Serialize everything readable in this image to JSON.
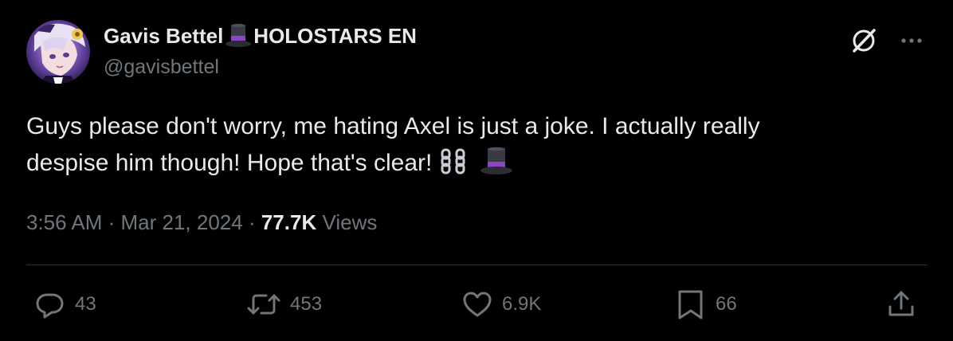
{
  "tweet": {
    "author": {
      "name_part1": "Gavis Bettel",
      "name_part2": "HOLOSTARS EN",
      "handle": "@gavisbettel",
      "avatar_icon": "avatar-image"
    },
    "text": {
      "line1": "Guys please don't worry, me hating Axel is just a joke. I actually really",
      "line2": "despise him though! Hope that's clear!"
    },
    "emojis": [
      "top-hat-emoji",
      "chains-emoji"
    ],
    "meta": {
      "time": "3:56 AM",
      "sep1": " · ",
      "date": "Mar 21, 2024",
      "sep2": " · ",
      "views_count": "77.7K",
      "views_label": " Views"
    },
    "actions": {
      "replies": "43",
      "reposts": "453",
      "likes": "6.9K",
      "bookmarks": "66"
    },
    "colors": {
      "background": "#000000",
      "text_primary": "#e7e9ea",
      "text_secondary": "#71767b",
      "divider": "#2f3336"
    }
  }
}
